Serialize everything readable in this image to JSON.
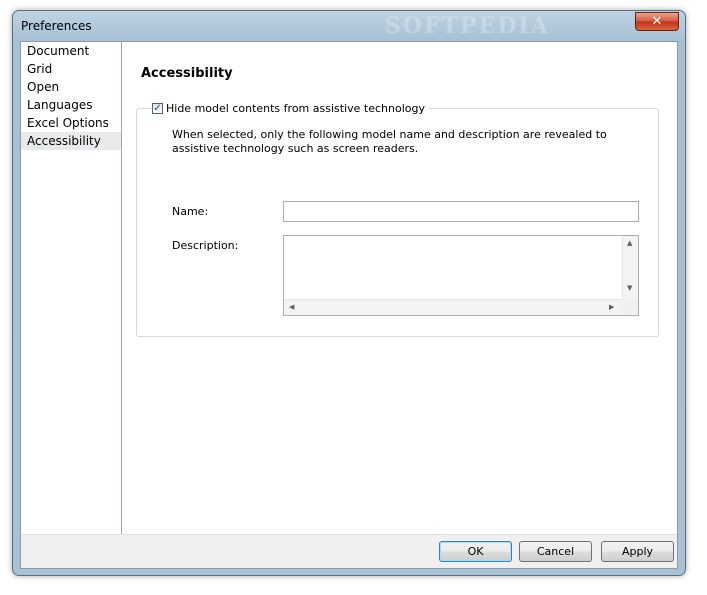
{
  "window": {
    "title": "Preferences",
    "watermark": "SOFTPEDIA",
    "close_glyph": "✕"
  },
  "sidebar": {
    "items": [
      {
        "label": "Document"
      },
      {
        "label": "Grid"
      },
      {
        "label": "Open"
      },
      {
        "label": "Languages"
      },
      {
        "label": "Excel Options"
      },
      {
        "label": "Accessibility",
        "selected": true
      }
    ]
  },
  "content": {
    "title": "Accessibility",
    "hide_checkbox": {
      "label": "Hide model contents from assistive technology",
      "checked": true
    },
    "description": "When selected, only the following model name and description are revealed to assistive technology such as screen readers.",
    "name_label": "Name:",
    "name_value": "",
    "description_label": "Description:",
    "description_value": ""
  },
  "buttons": {
    "ok": "OK",
    "cancel": "Cancel",
    "apply": "Apply"
  },
  "icons": {
    "check": "check-icon",
    "close": "close-icon"
  }
}
